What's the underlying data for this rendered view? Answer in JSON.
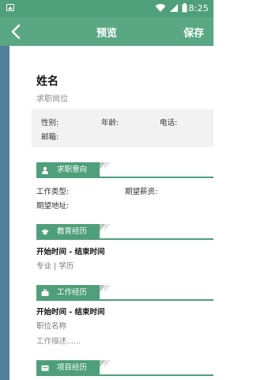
{
  "status": {
    "time": "8:25"
  },
  "appbar": {
    "title": "预览",
    "save": "保存"
  },
  "resume": {
    "name": "姓名",
    "job_title": "求职岗位",
    "basic": {
      "gender": "性别:",
      "age": "年龄:",
      "phone": "电话:",
      "email": "邮箱:"
    },
    "sections": {
      "intent": {
        "title": "求职意向",
        "job_type": "工作类型:",
        "salary": "期望薪资:",
        "location": "期望地址:"
      },
      "education": {
        "title": "教育经历",
        "period": "开始时间 - 结束时间",
        "detail": "专业 | 学历"
      },
      "work": {
        "title": "工作经历",
        "period": "开始时间 - 结束时间",
        "position": "职位名称",
        "desc": "工作描述......"
      },
      "project": {
        "title": "项目经历"
      }
    }
  },
  "colors": {
    "accent": "#4f9f7a",
    "appbar": "#5aa784",
    "strip": "#4f7f9a"
  },
  "icons": [
    "image-icon",
    "wifi-icon",
    "signal-icon",
    "battery-icon",
    "back-arrow-icon",
    "person-icon",
    "graduation-cap-icon",
    "briefcase-icon",
    "project-icon"
  ]
}
